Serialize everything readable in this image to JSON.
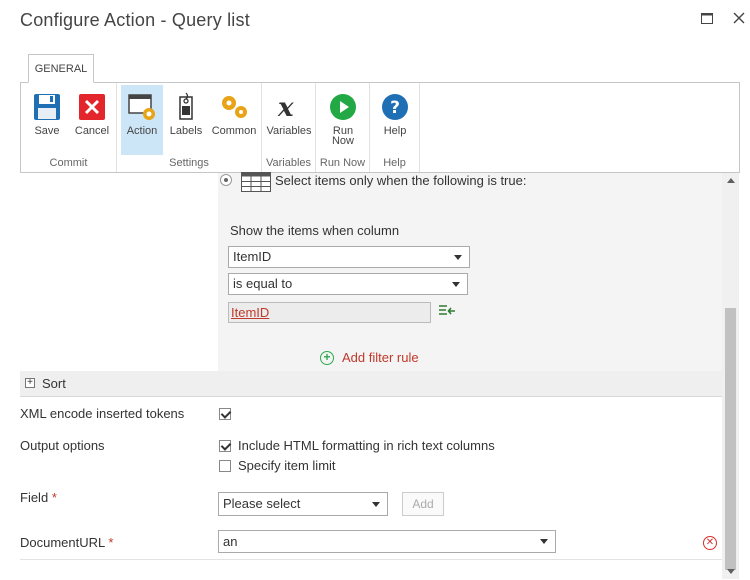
{
  "window": {
    "title": "Configure Action - Query list"
  },
  "ribbon": {
    "tab": "GENERAL",
    "groups": [
      {
        "label": "Commit"
      },
      {
        "label": "Settings"
      },
      {
        "label": "Variables"
      },
      {
        "label": "Run Now"
      },
      {
        "label": "Help"
      }
    ],
    "buttons": {
      "save": "Save",
      "cancel": "Cancel",
      "action": "Action",
      "labels": "Labels",
      "common": "Common",
      "variables": "Variables",
      "run_now_1": "Run",
      "run_now_2": "Now",
      "help": "Help"
    }
  },
  "filter": {
    "select_option_text": "Select items only when the following is true:",
    "show_items_text": "Show the items when column",
    "column_value": "ItemID",
    "operator_value": "is equal to",
    "token_value": "ItemID",
    "add_filter_rule": "Add filter rule"
  },
  "sort": {
    "label": "Sort"
  },
  "xml_encode": {
    "label": "XML encode inserted tokens",
    "checked": true
  },
  "output_options": {
    "label": "Output options",
    "include_html": {
      "label": "Include HTML formatting in rich text columns",
      "checked": true
    },
    "item_limit": {
      "label": "Specify item limit",
      "checked": false
    }
  },
  "field": {
    "label": "Field",
    "required_mark": "*",
    "select_value": "Please select",
    "add_button": "Add"
  },
  "document_url": {
    "label": "DocumentURL",
    "required_mark": "*",
    "value": "an"
  }
}
